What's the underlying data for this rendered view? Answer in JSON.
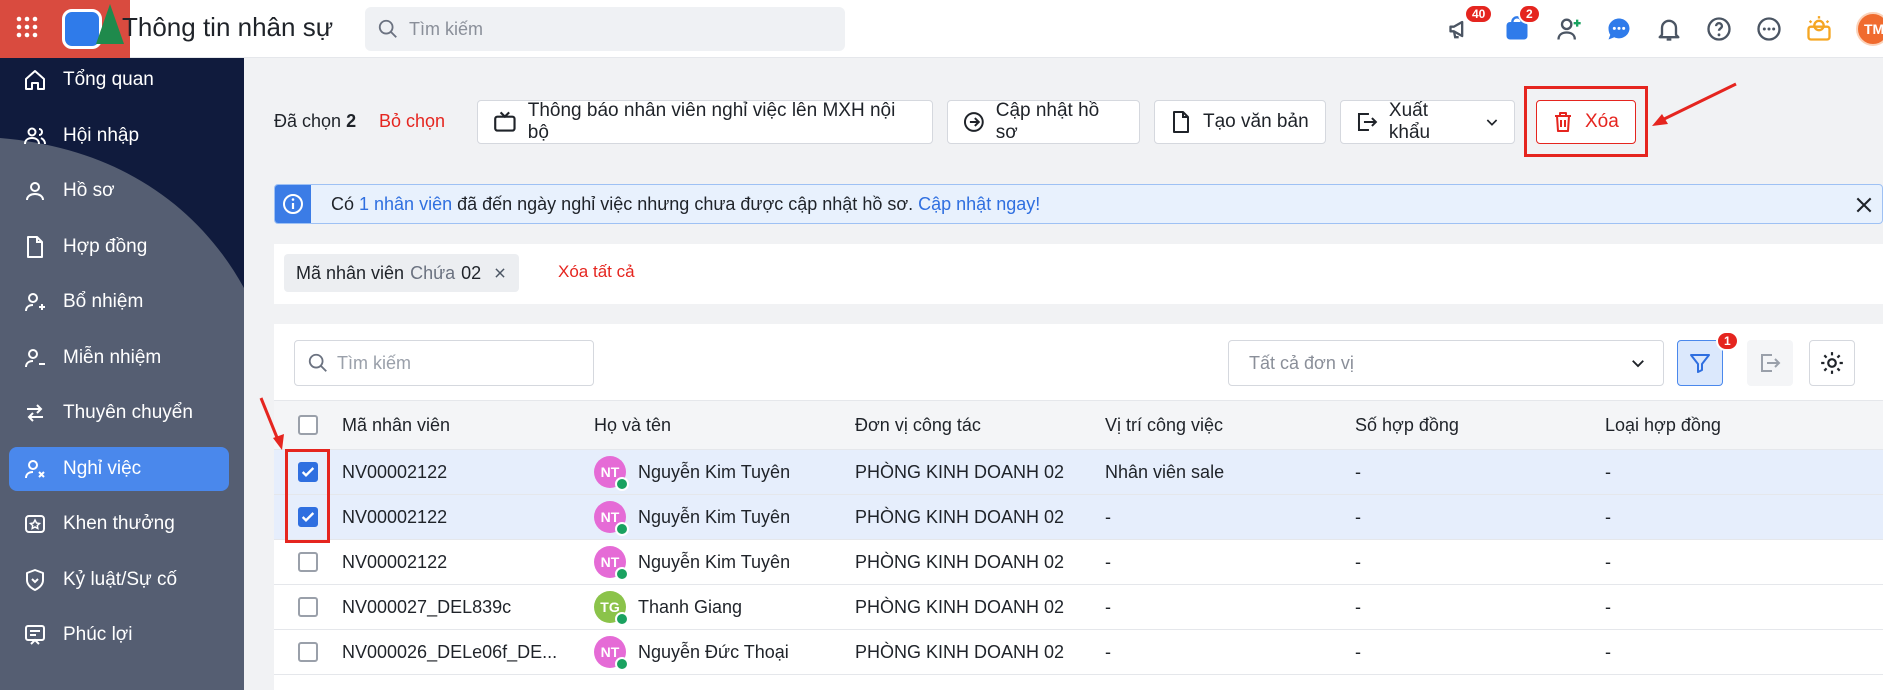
{
  "header": {
    "title": "Thông tin nhân sự",
    "search_placeholder": "Tìm kiếm",
    "notifications_badge": "40",
    "cart_badge": "2",
    "avatar_initials": "TM"
  },
  "sidebar": {
    "items": [
      {
        "label": "Tổng quan",
        "icon": "home-icon"
      },
      {
        "label": "Hội nhập",
        "icon": "users-icon"
      },
      {
        "label": "Hồ sơ",
        "icon": "user-icon"
      },
      {
        "label": "Hợp đồng",
        "icon": "document-icon"
      },
      {
        "label": "Bổ nhiệm",
        "icon": "user-plus-icon"
      },
      {
        "label": "Miễn nhiệm",
        "icon": "user-minus-icon"
      },
      {
        "label": "Thuyên chuyển",
        "icon": "transfer-icon"
      },
      {
        "label": "Nghỉ việc",
        "icon": "user-x-icon",
        "active": true
      },
      {
        "label": "Khen thưởng",
        "icon": "award-icon"
      },
      {
        "label": "Kỷ luật/Sự cố",
        "icon": "shield-icon"
      },
      {
        "label": "Phúc lợi",
        "icon": "benefit-icon"
      }
    ]
  },
  "toolbar": {
    "selected_prefix": "Đã chọn",
    "selected_count": "2",
    "unselect": "Bỏ chọn",
    "notify_btn": "Thông báo nhân viên nghỉ việc lên MXH nội bộ",
    "update_btn": "Cập nhật hồ sơ",
    "create_doc_btn": "Tạo văn bản",
    "export_btn": "Xuất khẩu",
    "delete_btn": "Xóa"
  },
  "alert": {
    "prefix": "Có",
    "link_count": "1 nhân viên",
    "message": "đã đến ngày nghỉ việc nhưng chưa được cập nhật hồ sơ.",
    "action": "Cập nhật ngay!"
  },
  "filter": {
    "chip_field": "Mã nhân viên",
    "chip_op": "Chứa",
    "chip_value": "02",
    "clear_all": "Xóa tất cả"
  },
  "table": {
    "search_placeholder": "Tìm kiếm",
    "unit_placeholder": "Tất cả đơn vị",
    "filter_badge": "1",
    "columns": [
      "Mã nhân viên",
      "Họ và tên",
      "Đơn vị công tác",
      "Vị trí công việc",
      "Số hợp đồng",
      "Loại hợp đồng"
    ],
    "rows": [
      {
        "checked": true,
        "code": "NV00002122",
        "initials": "NT",
        "avatar_color": "#e56bd6",
        "name": "Nguyễn Kim Tuyên",
        "unit": "PHÒNG KINH DOANH 02",
        "position": "Nhân viên sale",
        "contract_no": "-",
        "contract_type": "-"
      },
      {
        "checked": true,
        "code": "NV00002122",
        "initials": "NT",
        "avatar_color": "#e56bd6",
        "name": "Nguyễn Kim Tuyên",
        "unit": "PHÒNG KINH DOANH 02",
        "position": "-",
        "contract_no": "-",
        "contract_type": "-"
      },
      {
        "checked": false,
        "code": "NV00002122",
        "initials": "NT",
        "avatar_color": "#e56bd6",
        "name": "Nguyễn Kim Tuyên",
        "unit": "PHÒNG KINH DOANH 02",
        "position": "-",
        "contract_no": "-",
        "contract_type": "-"
      },
      {
        "checked": false,
        "code": "NV000027_DEL839c",
        "initials": "TG",
        "avatar_color": "#8bc34a",
        "name": "Thanh Giang",
        "unit": "PHÒNG KINH DOANH 02",
        "position": "-",
        "contract_no": "-",
        "contract_type": "-"
      },
      {
        "checked": false,
        "code": "NV000026_DELe06f_DE...",
        "initials": "NT",
        "avatar_color": "#e56bd6",
        "name": "Nguyễn Đức Thoại",
        "unit": "PHÒNG KINH DOANH 02",
        "position": "-",
        "contract_no": "-",
        "contract_type": "-"
      }
    ]
  },
  "colors": {
    "accent": "#2f6fe0",
    "danger": "#e5251f",
    "sidebar": "#555e72"
  }
}
